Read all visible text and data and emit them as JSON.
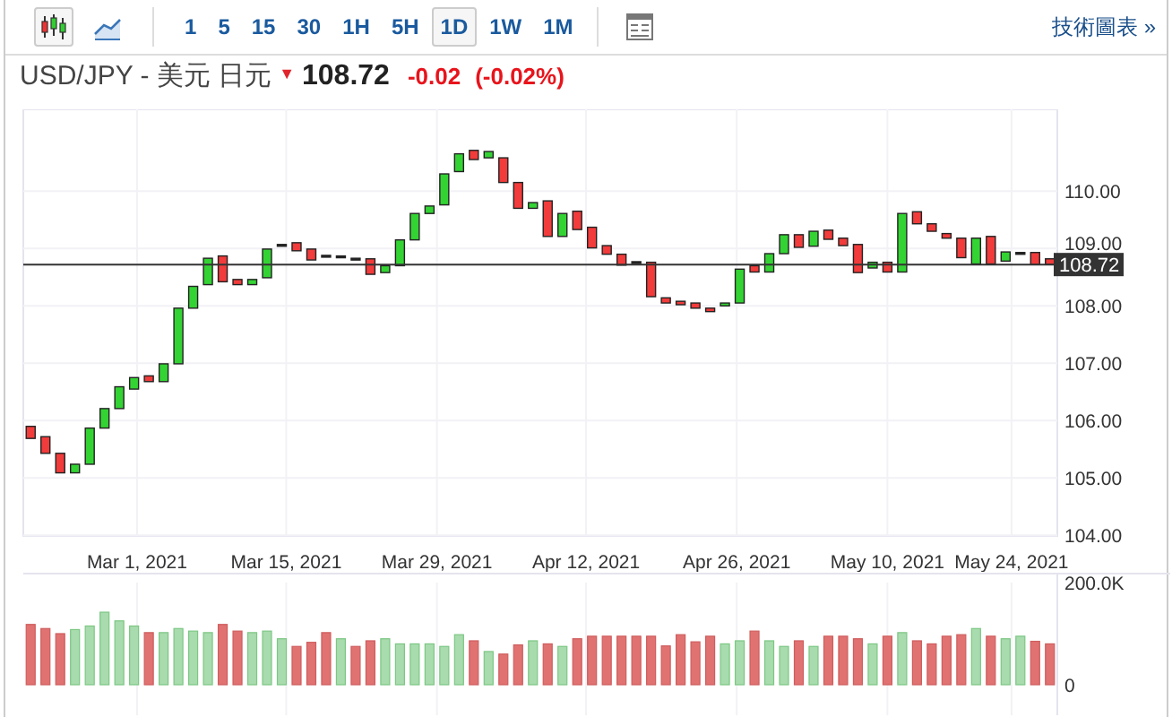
{
  "toolbar": {
    "chart_types": [
      {
        "kind": "candlestick",
        "selected": true
      },
      {
        "kind": "line",
        "selected": false
      }
    ],
    "intervals": [
      {
        "label": "1",
        "selected": false
      },
      {
        "label": "5",
        "selected": false
      },
      {
        "label": "15",
        "selected": false
      },
      {
        "label": "30",
        "selected": false
      },
      {
        "label": "1H",
        "selected": false
      },
      {
        "label": "5H",
        "selected": false
      },
      {
        "label": "1D",
        "selected": true
      },
      {
        "label": "1W",
        "selected": false
      },
      {
        "label": "1M",
        "selected": false
      }
    ],
    "link": "技術圖表 »"
  },
  "quote": {
    "title": "USD/JPY - 美元 日元",
    "arrow": "▼",
    "price": "108.72",
    "change": "-0.02",
    "change_percent": "(-0.02%)"
  },
  "price_chart": {
    "price_label": "108.72",
    "y_labels": [
      "110.00",
      "109.00",
      "108.00",
      "107.00",
      "106.00",
      "105.00",
      "104.00"
    ],
    "x_labels": [
      "Mar 1, 2021",
      "Mar 15, 2021",
      "Mar 29, 2021",
      "Apr 12, 2021",
      "Apr 26, 2021",
      "May 10, 2021",
      "May 24, 2021"
    ]
  },
  "volume_chart": {
    "y_labels": [
      "200.0K",
      "0"
    ]
  }
}
